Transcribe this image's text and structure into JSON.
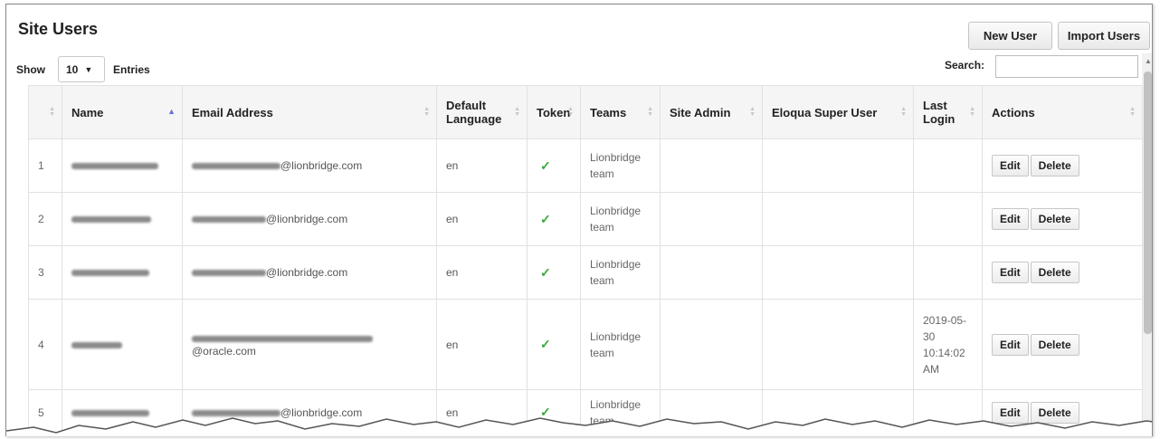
{
  "page": {
    "title": "Site Users",
    "new_user_label": "New User",
    "import_users_label": "Import Users"
  },
  "controls": {
    "show_label": "Show",
    "entries_value": "10",
    "entries_label": "Entries",
    "search_label": "Search:",
    "search_value": ""
  },
  "table": {
    "columns": [
      {
        "label": "",
        "sort": "both"
      },
      {
        "label": "Name",
        "sort": "asc"
      },
      {
        "label": "Email Address",
        "sort": "both"
      },
      {
        "label": "Default Language",
        "sort": "both"
      },
      {
        "label": "Token",
        "sort": "both"
      },
      {
        "label": "Teams",
        "sort": "both"
      },
      {
        "label": "Site Admin",
        "sort": "both"
      },
      {
        "label": "Eloqua Super User",
        "sort": "both"
      },
      {
        "label": "Last Login",
        "sort": "both"
      },
      {
        "label": "Actions",
        "sort": "both"
      }
    ],
    "rows": [
      {
        "num": "1",
        "email_domain": "@lionbridge.com",
        "language": "en",
        "token": "✓",
        "teams": "Lionbridge team",
        "last_login": "",
        "edit": "Edit",
        "delete": "Delete"
      },
      {
        "num": "2",
        "email_domain": "@lionbridge.com",
        "language": "en",
        "token": "✓",
        "teams": "Lionbridge team",
        "last_login": "",
        "edit": "Edit",
        "delete": "Delete"
      },
      {
        "num": "3",
        "email_domain": "@lionbridge.com",
        "language": "en",
        "token": "✓",
        "teams": "Lionbridge team",
        "last_login": "",
        "edit": "Edit",
        "delete": "Delete"
      },
      {
        "num": "4",
        "email_domain": "@oracle.com",
        "language": "en",
        "token": "✓",
        "teams": "Lionbridge team",
        "last_login": "2019-05-30 10:14:02 AM",
        "edit": "Edit",
        "delete": "Delete"
      },
      {
        "num": "5",
        "email_domain": "@lionbridge.com",
        "language": "en",
        "token": "✓",
        "teams": "Lionbridge team",
        "last_login": "",
        "edit": "Edit",
        "delete": "Delete"
      }
    ]
  },
  "colors": {
    "token_check": "#3aa83a",
    "sort_active": "#6a6fd6"
  },
  "icons": {
    "token_check": "check-icon",
    "sort": "sort-icon",
    "dropdown": "chevron-down-icon"
  }
}
